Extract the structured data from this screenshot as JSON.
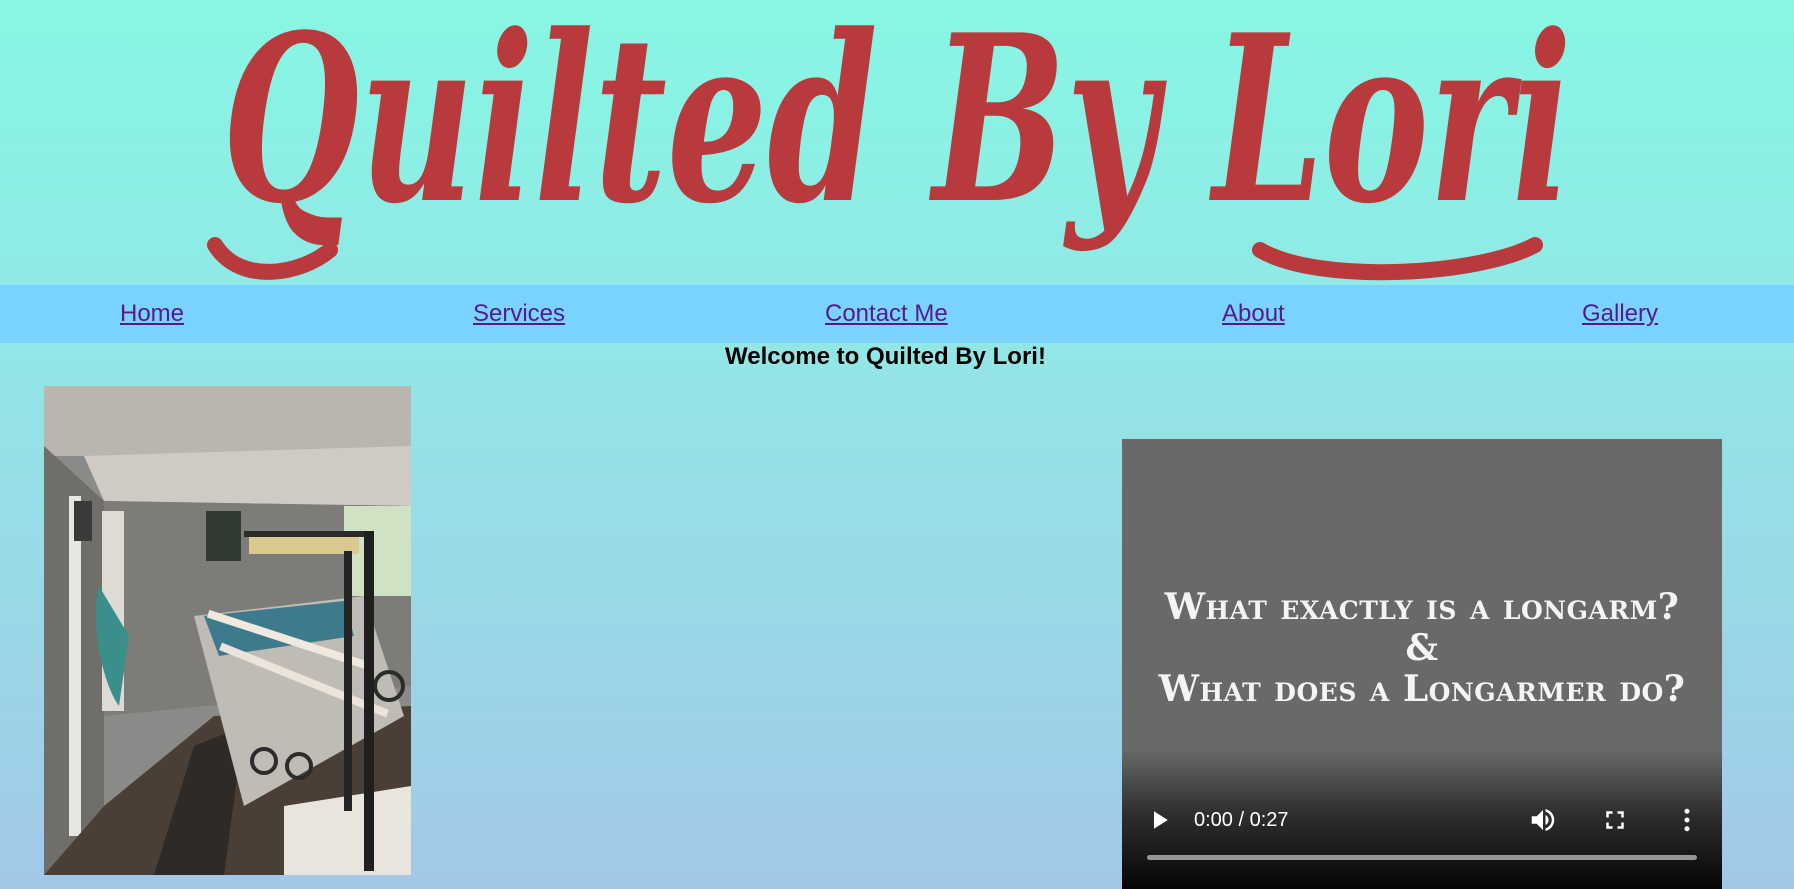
{
  "banner": {
    "logo_text": "Quilted By Lori",
    "logo_color": "#b83a3d"
  },
  "nav": {
    "background": "#79d2ff",
    "link_color": "#551a8b",
    "items": [
      {
        "label": "Home"
      },
      {
        "label": "Services"
      },
      {
        "label": "Contact Me"
      },
      {
        "label": "About"
      },
      {
        "label": "Gallery"
      }
    ]
  },
  "main": {
    "welcome": "Welcome to Quilted By Lori!",
    "photo_icon": "quilting-room-photo"
  },
  "video": {
    "title_line1": "What exactly is a longarm?",
    "title_line2": "&",
    "title_line3": "What does a Longarmer do?",
    "time_display": "0:00 / 0:27",
    "progress": 0,
    "icons": {
      "play": "play-icon",
      "volume": "volume-icon",
      "fullscreen": "fullscreen-icon",
      "more": "more-options-icon"
    }
  }
}
